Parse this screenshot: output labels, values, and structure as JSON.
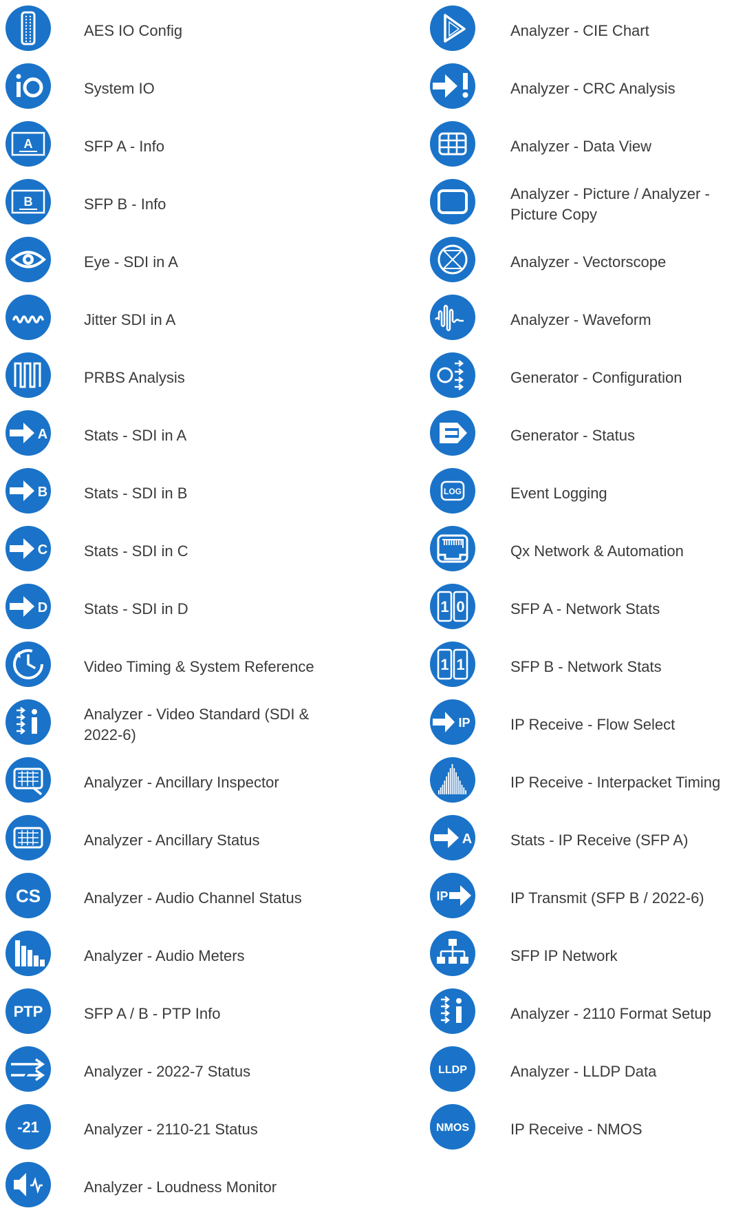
{
  "accent": "#1a73c8",
  "left": [
    {
      "icon": "aes-connector-icon",
      "label": "AES IO Config"
    },
    {
      "icon": "io-icon",
      "label": "System IO"
    },
    {
      "icon": "sfp-a-icon",
      "label": "SFP A - Info"
    },
    {
      "icon": "sfp-b-icon",
      "label": "SFP B - Info"
    },
    {
      "icon": "eye-icon",
      "label": "Eye - SDI in A"
    },
    {
      "icon": "jitter-wave-icon",
      "label": "Jitter SDI in A"
    },
    {
      "icon": "prbs-pulse-icon",
      "label": "PRBS Analysis"
    },
    {
      "icon": "arrow-a-icon",
      "label": "Stats - SDI in A"
    },
    {
      "icon": "arrow-b-icon",
      "label": "Stats - SDI in B"
    },
    {
      "icon": "arrow-c-icon",
      "label": "Stats - SDI in C"
    },
    {
      "icon": "arrow-d-icon",
      "label": "Stats - SDI in D"
    },
    {
      "icon": "clock-refresh-icon",
      "label": "Video Timing & System Reference"
    },
    {
      "icon": "arrows-info-icon",
      "label": "Analyzer - Video Standard (SDI & 2022-6)"
    },
    {
      "icon": "ancillary-inspector-icon",
      "label": "Analyzer - Ancillary Inspector"
    },
    {
      "icon": "ancillary-status-icon",
      "label": "Analyzer - Ancillary Status"
    },
    {
      "icon": "cs-icon",
      "label": "Analyzer - Audio Channel Status",
      "text": "CS"
    },
    {
      "icon": "audio-meters-icon",
      "label": "Analyzer - Audio Meters"
    },
    {
      "icon": "ptp-icon",
      "label": "SFP A / B - PTP Info",
      "text": "PTP"
    },
    {
      "icon": "dual-arrows-icon",
      "label": "Analyzer - 2022-7 Status"
    },
    {
      "icon": "minus-21-icon",
      "label": "Analyzer - 2110-21 Status",
      "text": "-21"
    },
    {
      "icon": "loudness-icon",
      "label": "Analyzer - Loudness Monitor"
    }
  ],
  "right": [
    {
      "icon": "cie-triangle-icon",
      "label": "Analyzer - CIE Chart"
    },
    {
      "icon": "arrow-alert-icon",
      "label": "Analyzer - CRC Analysis"
    },
    {
      "icon": "grid-table-icon",
      "label": "Analyzer - Data View"
    },
    {
      "icon": "picture-frame-icon",
      "label": "Analyzer - Picture / Analyzer - Picture Copy"
    },
    {
      "icon": "vectorscope-icon",
      "label": "Analyzer - Vectorscope"
    },
    {
      "icon": "waveform-icon",
      "label": "Analyzer - Waveform"
    },
    {
      "icon": "generator-config-icon",
      "label": "Generator - Configuration"
    },
    {
      "icon": "generator-status-icon",
      "label": "Generator - Status"
    },
    {
      "icon": "log-icon",
      "label": "Event Logging",
      "text": "LOG"
    },
    {
      "icon": "network-port-icon",
      "label": "Qx Network & Automation"
    },
    {
      "icon": "counter-10-icon",
      "label": "SFP A - Network Stats"
    },
    {
      "icon": "counter-11-icon",
      "label": "SFP B - Network Stats"
    },
    {
      "icon": "arrow-ip-icon",
      "label": "IP Receive - Flow Select"
    },
    {
      "icon": "interpacket-icon",
      "label": "IP Receive - Interpacket Timing"
    },
    {
      "icon": "arrow-a-icon",
      "label": "Stats - IP Receive (SFP A)"
    },
    {
      "icon": "ip-arrow-icon",
      "label": "IP Transmit (SFP B / 2022-6)"
    },
    {
      "icon": "network-tree-icon",
      "label": "SFP IP Network"
    },
    {
      "icon": "arrows-info-icon",
      "label": "Analyzer - 2110 Format Setup"
    },
    {
      "icon": "lldp-icon",
      "label": "Analyzer - LLDP Data",
      "text": "LLDP"
    },
    {
      "icon": "nmos-icon",
      "label": "IP Receive - NMOS",
      "text": "NMOS"
    }
  ]
}
